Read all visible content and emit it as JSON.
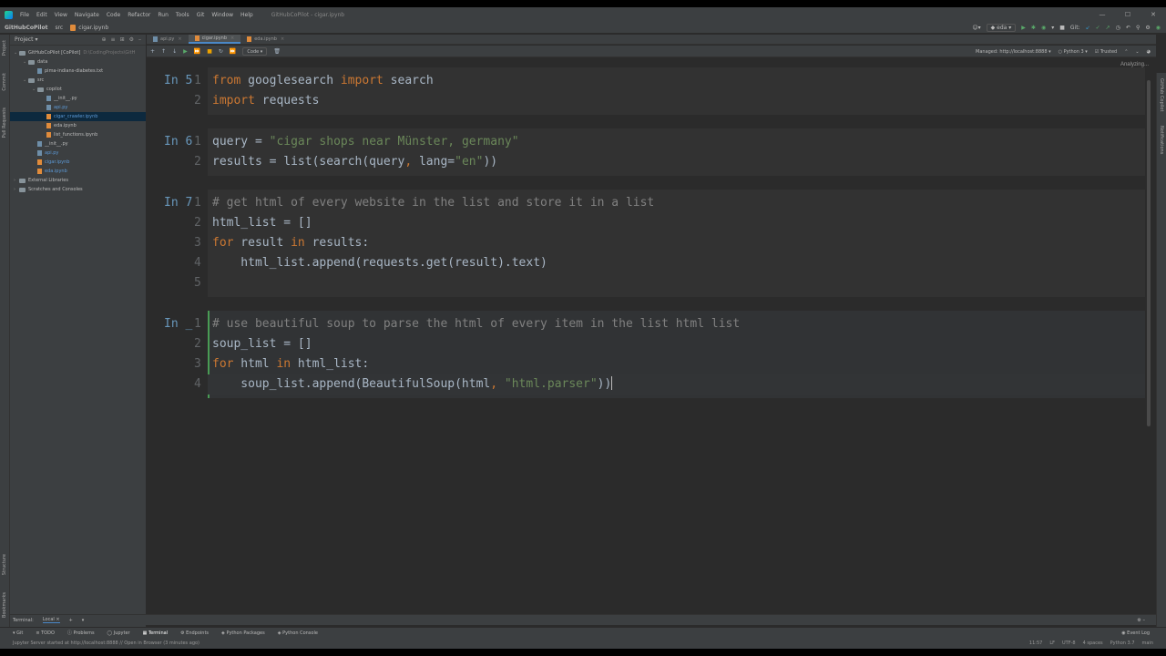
{
  "window": {
    "title": "GitHubCoPilot - cigar.ipynb",
    "menu": [
      "File",
      "Edit",
      "View",
      "Navigate",
      "Code",
      "Refactor",
      "Run",
      "Tools",
      "Git",
      "Window",
      "Help"
    ],
    "controls": [
      "—",
      "☐",
      "✕"
    ]
  },
  "navbar": {
    "crumbs": [
      "GitHubCoPilot",
      "src",
      "cigar.ipynb"
    ],
    "run_config": "eda",
    "git_label": "Git:"
  },
  "project": {
    "header": "Project",
    "tree": [
      {
        "label": "GitHubCoPilot [CoPilot]",
        "extra": "D:\\CodingProjects\\GitH",
        "depth": 0,
        "type": "folder",
        "open": true
      },
      {
        "label": "data",
        "depth": 1,
        "type": "folder",
        "open": true
      },
      {
        "label": "pima-indians-diabetes.txt",
        "depth": 2,
        "type": "file"
      },
      {
        "label": "src",
        "depth": 1,
        "type": "folder",
        "open": true
      },
      {
        "label": "copilot",
        "depth": 2,
        "type": "folder",
        "open": true
      },
      {
        "label": "__init__.py",
        "depth": 3,
        "type": "file"
      },
      {
        "label": "api.py",
        "depth": 3,
        "type": "file",
        "blue": true
      },
      {
        "label": "cigar_crawler.ipynb",
        "depth": 3,
        "type": "nb",
        "blue": true,
        "selected": true
      },
      {
        "label": "eda.ipynb",
        "depth": 3,
        "type": "nb"
      },
      {
        "label": "list_functions.ipynb",
        "depth": 3,
        "type": "nb"
      },
      {
        "label": "__init__.py",
        "depth": 2,
        "type": "file"
      },
      {
        "label": "api.py",
        "depth": 2,
        "type": "file",
        "blue": true
      },
      {
        "label": "cigar.ipynb",
        "depth": 2,
        "type": "nb",
        "blue": true
      },
      {
        "label": "eda.ipynb",
        "depth": 2,
        "type": "nb",
        "blue": true
      },
      {
        "label": "External Libraries",
        "depth": 0,
        "type": "folder"
      },
      {
        "label": "Scratches and Consoles",
        "depth": 0,
        "type": "folder"
      }
    ]
  },
  "tabs": [
    {
      "label": "api.py",
      "active": false,
      "nb": false
    },
    {
      "label": "cigar.ipynb",
      "active": true,
      "nb": true
    },
    {
      "label": "eda.ipynb",
      "active": false,
      "nb": true
    }
  ],
  "nbtoolbar": {
    "cell_type": "Code",
    "server": "Managed: http://localhost:8888",
    "kernel": "Python 3",
    "trusted": "Trusted",
    "analyzing": "Analyzing..."
  },
  "cells": [
    {
      "prompt": "In 5",
      "lines": [
        [
          [
            "kw",
            "from"
          ],
          [
            "t",
            " googlesearch "
          ],
          [
            "kw",
            "import"
          ],
          [
            "t",
            " search"
          ]
        ],
        [
          [
            "kw",
            "import"
          ],
          [
            "t",
            " requests"
          ]
        ]
      ]
    },
    {
      "prompt": "In 6",
      "lines": [
        [
          [
            "t",
            "query = "
          ],
          [
            "str",
            "\"cigar shops near Münster, germany\""
          ]
        ],
        [
          [
            "t",
            "results = list(search(query"
          ],
          [
            "kw",
            ","
          ],
          [
            "t",
            " lang="
          ],
          [
            "str",
            "\"en\""
          ],
          [
            "t",
            "))"
          ]
        ]
      ]
    },
    {
      "prompt": "In 7",
      "lines": [
        [
          [
            "cm",
            "# get html of every website in the list and store it in a list"
          ]
        ],
        [
          [
            "t",
            "html_list = []"
          ]
        ],
        [
          [
            "kw",
            "for"
          ],
          [
            "t",
            " result "
          ],
          [
            "kw",
            "in"
          ],
          [
            "t",
            " results:"
          ]
        ],
        [
          [
            "t",
            "    html_list.append(requests.get(result).text)"
          ]
        ],
        [
          [
            "t",
            ""
          ]
        ]
      ]
    },
    {
      "prompt": "In _",
      "active": true,
      "lines": [
        [
          [
            "cm",
            "# use beautiful soup to parse the html of every item in the list html list"
          ]
        ],
        [
          [
            "t",
            "soup_list = []"
          ]
        ],
        [
          [
            "kw",
            "for"
          ],
          [
            "t",
            " html "
          ],
          [
            "kw",
            "in"
          ],
          [
            "t",
            " html_list:"
          ]
        ],
        [
          [
            "t",
            "    soup_list.append(BeautifulSoup(html"
          ],
          [
            "kw",
            ","
          ],
          [
            "t",
            " "
          ],
          [
            "str",
            "\"html.parser\""
          ],
          [
            "t",
            "))"
          ]
        ]
      ]
    }
  ],
  "bottom": {
    "terminal_label": "Terminal:",
    "terminal_tab": "Local",
    "tools": [
      "Git",
      "TODO",
      "Problems",
      "Jupyter",
      "Terminal",
      "Endpoints",
      "Python Packages",
      "Python Console"
    ],
    "event_log": "Event Log"
  },
  "status": {
    "message": "Jupyter Server started at http://localhost:8888 // Open in Browser (3 minutes ago)",
    "right": [
      "11:57",
      "LF",
      "UTF-8",
      "4 spaces",
      "Python 3.7",
      "main"
    ]
  }
}
